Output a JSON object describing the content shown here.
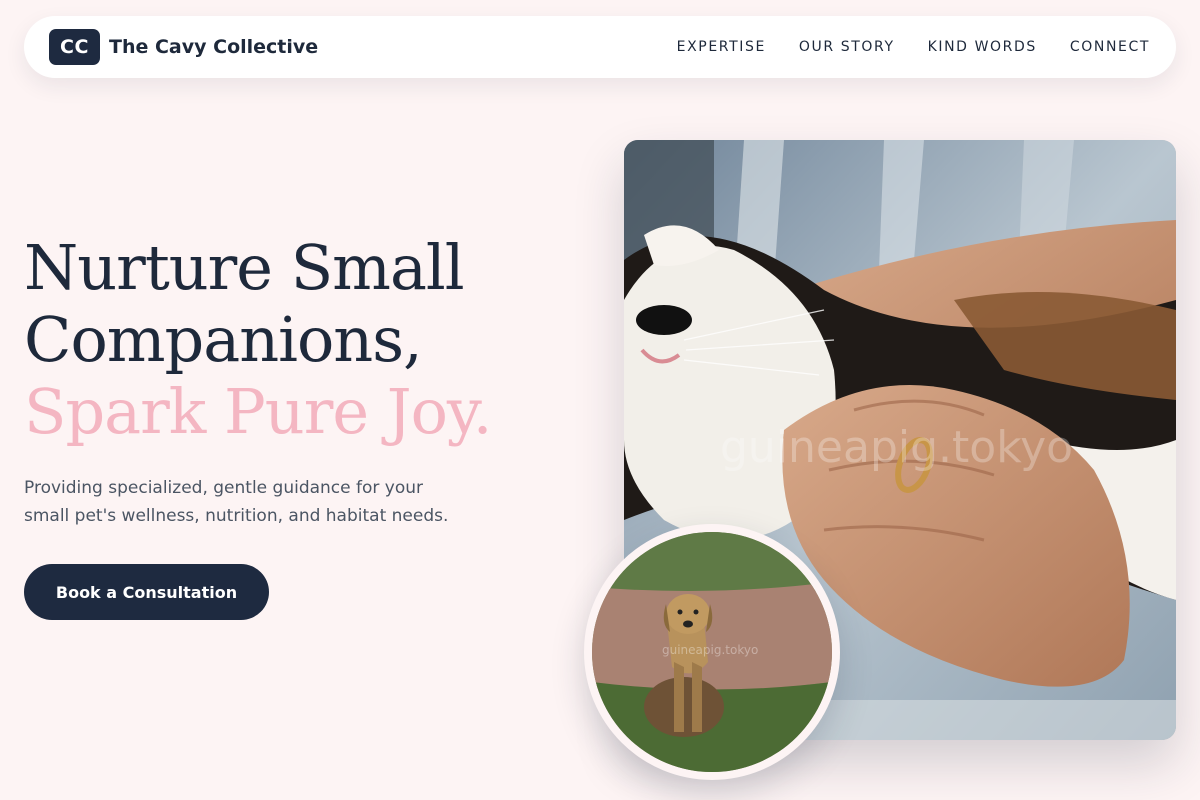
{
  "brand": {
    "logo_text": "CC",
    "name": "The Cavy Collective"
  },
  "nav": {
    "links": [
      {
        "label": "EXPERTISE"
      },
      {
        "label": "OUR STORY"
      },
      {
        "label": "KIND WORDS"
      },
      {
        "label": "CONNECT"
      }
    ]
  },
  "hero": {
    "headline_line1": "Nurture Small",
    "headline_line2": "Companions,",
    "headline_accent": "Spark Pure Joy.",
    "subtext": "Providing specialized, gentle guidance for your small pet's wellness, nutrition, and habitat needs.",
    "cta_label": "Book a Consultation"
  },
  "images": {
    "main_watermark": "guineapig.tokyo",
    "circle_watermark": "guineapig.tokyo"
  },
  "colors": {
    "background": "#fdf4f4",
    "navy": "#1e2a40",
    "accent_pink": "#f4b6c2"
  }
}
